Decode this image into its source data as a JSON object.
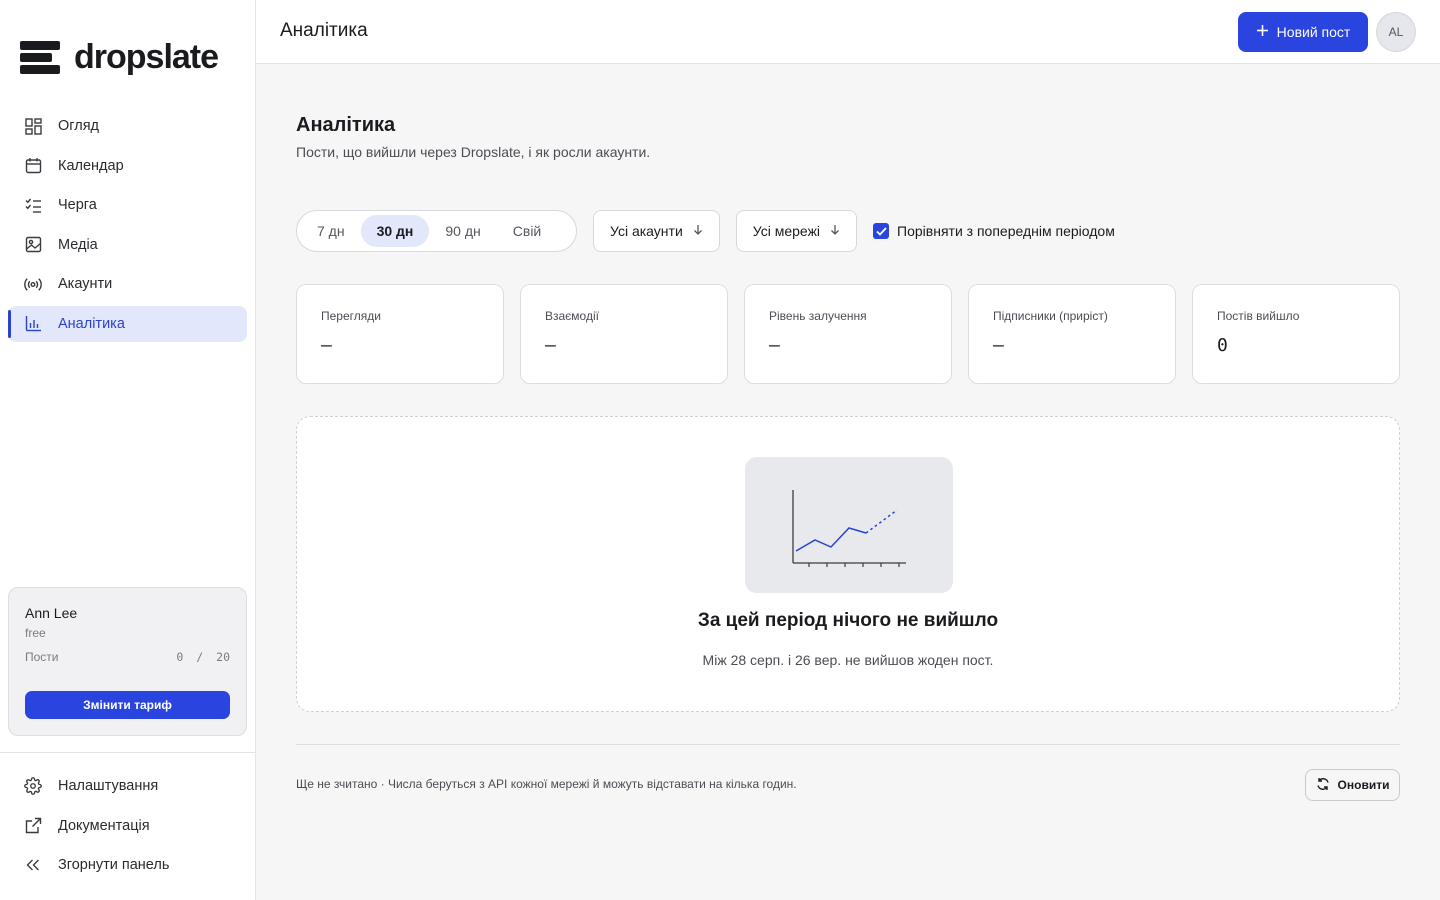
{
  "brand": {
    "name": "dropslate"
  },
  "sidebar": {
    "items": [
      {
        "label": "Огляд",
        "icon": "grid-icon",
        "active": false
      },
      {
        "label": "Календар",
        "icon": "calendar-icon",
        "active": false
      },
      {
        "label": "Черга",
        "icon": "checklist-icon",
        "active": false
      },
      {
        "label": "Медіа",
        "icon": "image-icon",
        "active": false
      },
      {
        "label": "Акаунти",
        "icon": "broadcast-icon",
        "active": false
      },
      {
        "label": "Аналітика",
        "icon": "bar-chart-icon",
        "active": true
      }
    ],
    "plan": {
      "user": "Ann Lee",
      "tier": "free",
      "posts_label": "Пости",
      "posts_used": "0",
      "posts_sep": "/",
      "posts_limit": "20",
      "change_plan": "Змінити тариф"
    },
    "bottom": [
      {
        "label": "Налаштування",
        "icon": "gear-icon"
      },
      {
        "label": "Документація",
        "icon": "external-link-icon"
      },
      {
        "label": "Згорнути панель",
        "icon": "double-chevron-left-icon"
      }
    ]
  },
  "header": {
    "title": "Аналітика",
    "new_post": "Новий пост",
    "avatar_initials": "AL"
  },
  "page": {
    "title": "Аналітика",
    "subtitle": "Пости, що вийшли через Dropslate, і як росли акаунти.",
    "ranges": [
      "7 дн",
      "30 дн",
      "90 дн",
      "Свій"
    ],
    "range_selected": "30 дн",
    "accounts_filter": "Усі акаунти",
    "networks_filter": "Усі мережі",
    "compare_label": "Порівняти з попереднім періодом",
    "compare_checked": true
  },
  "stats": [
    {
      "label": "Перегляди",
      "value": "—"
    },
    {
      "label": "Взаємодії",
      "value": "—"
    },
    {
      "label": "Рівень залучення",
      "value": "—"
    },
    {
      "label": "Підписники (приріст)",
      "value": "—"
    },
    {
      "label": "Постів вийшло",
      "value": "0"
    }
  ],
  "empty": {
    "title": "За цей період нічого не вийшло",
    "subtitle": "Між 28 серп. і 26 вер. не вийшов жоден пост."
  },
  "footer": {
    "note": "Ще не зчитано · Числа беруться з API кожної мережі й можуть відставати на кілька годин.",
    "refresh": "Оновити"
  },
  "colors": {
    "accent": "#2a44e0",
    "active_bg": "#e2e7fb",
    "background": "#f6f6f7"
  }
}
